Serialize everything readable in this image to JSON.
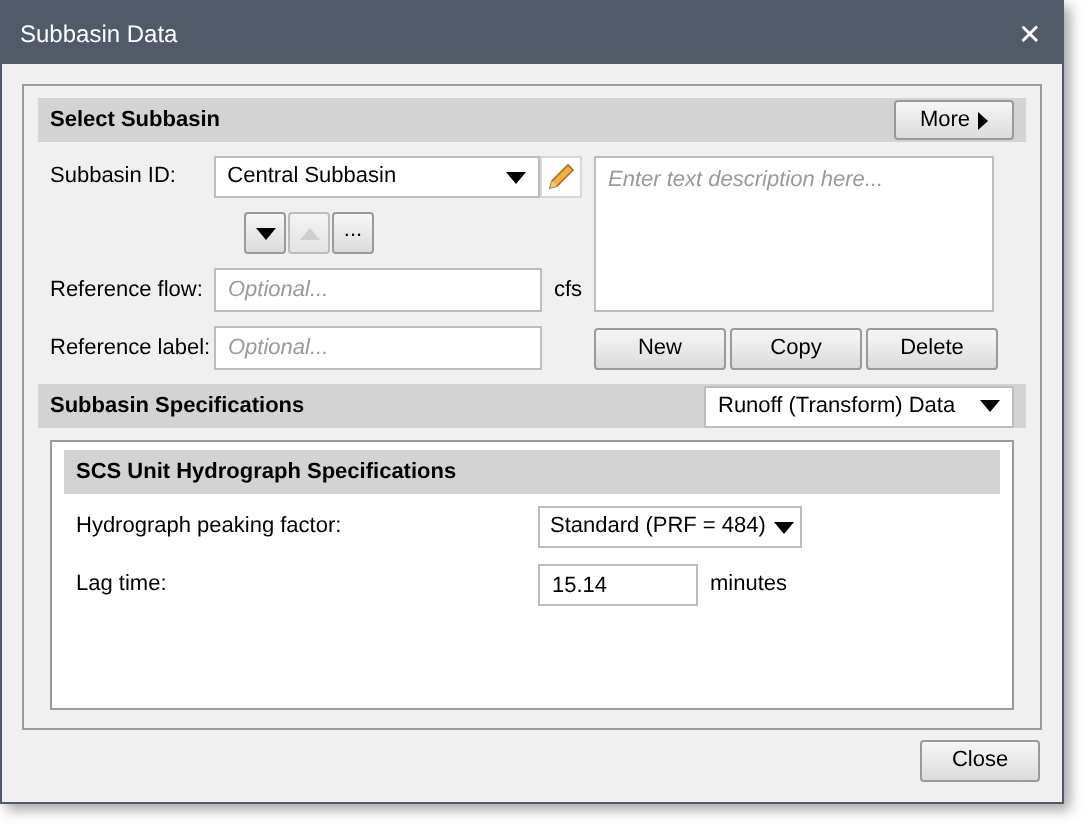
{
  "window": {
    "title": "Subbasin Data",
    "close_glyph": "✕"
  },
  "select_subbasin": {
    "header": "Select Subbasin",
    "more_button": "More",
    "subbasin_id": {
      "label": "Subbasin ID:",
      "value": "Central Subbasin"
    },
    "nav_buttons": [
      {
        "kind": "down",
        "disabled": false
      },
      {
        "kind": "up",
        "disabled": true
      },
      {
        "kind": "text",
        "label": "...",
        "disabled": false
      }
    ],
    "reference_flow": {
      "label": "Reference flow:",
      "placeholder": "Optional...",
      "unit": "cfs"
    },
    "reference_label": {
      "label": "Reference label:",
      "placeholder": "Optional..."
    },
    "description": {
      "placeholder": "Enter text description here..."
    },
    "buttons": [
      "New",
      "Copy",
      "Delete"
    ]
  },
  "specifications": {
    "header": "Subbasin Specifications",
    "view": "Runoff (Transform) Data",
    "group": {
      "header": "SCS Unit Hydrograph Specifications",
      "peaking_factor": {
        "label": "Hydrograph peaking factor:",
        "value": "Standard (PRF = 484)"
      },
      "lag_time": {
        "label": "Lag time:",
        "value": "15.14",
        "unit": "minutes"
      }
    }
  },
  "footer": {
    "close_button": "Close"
  }
}
